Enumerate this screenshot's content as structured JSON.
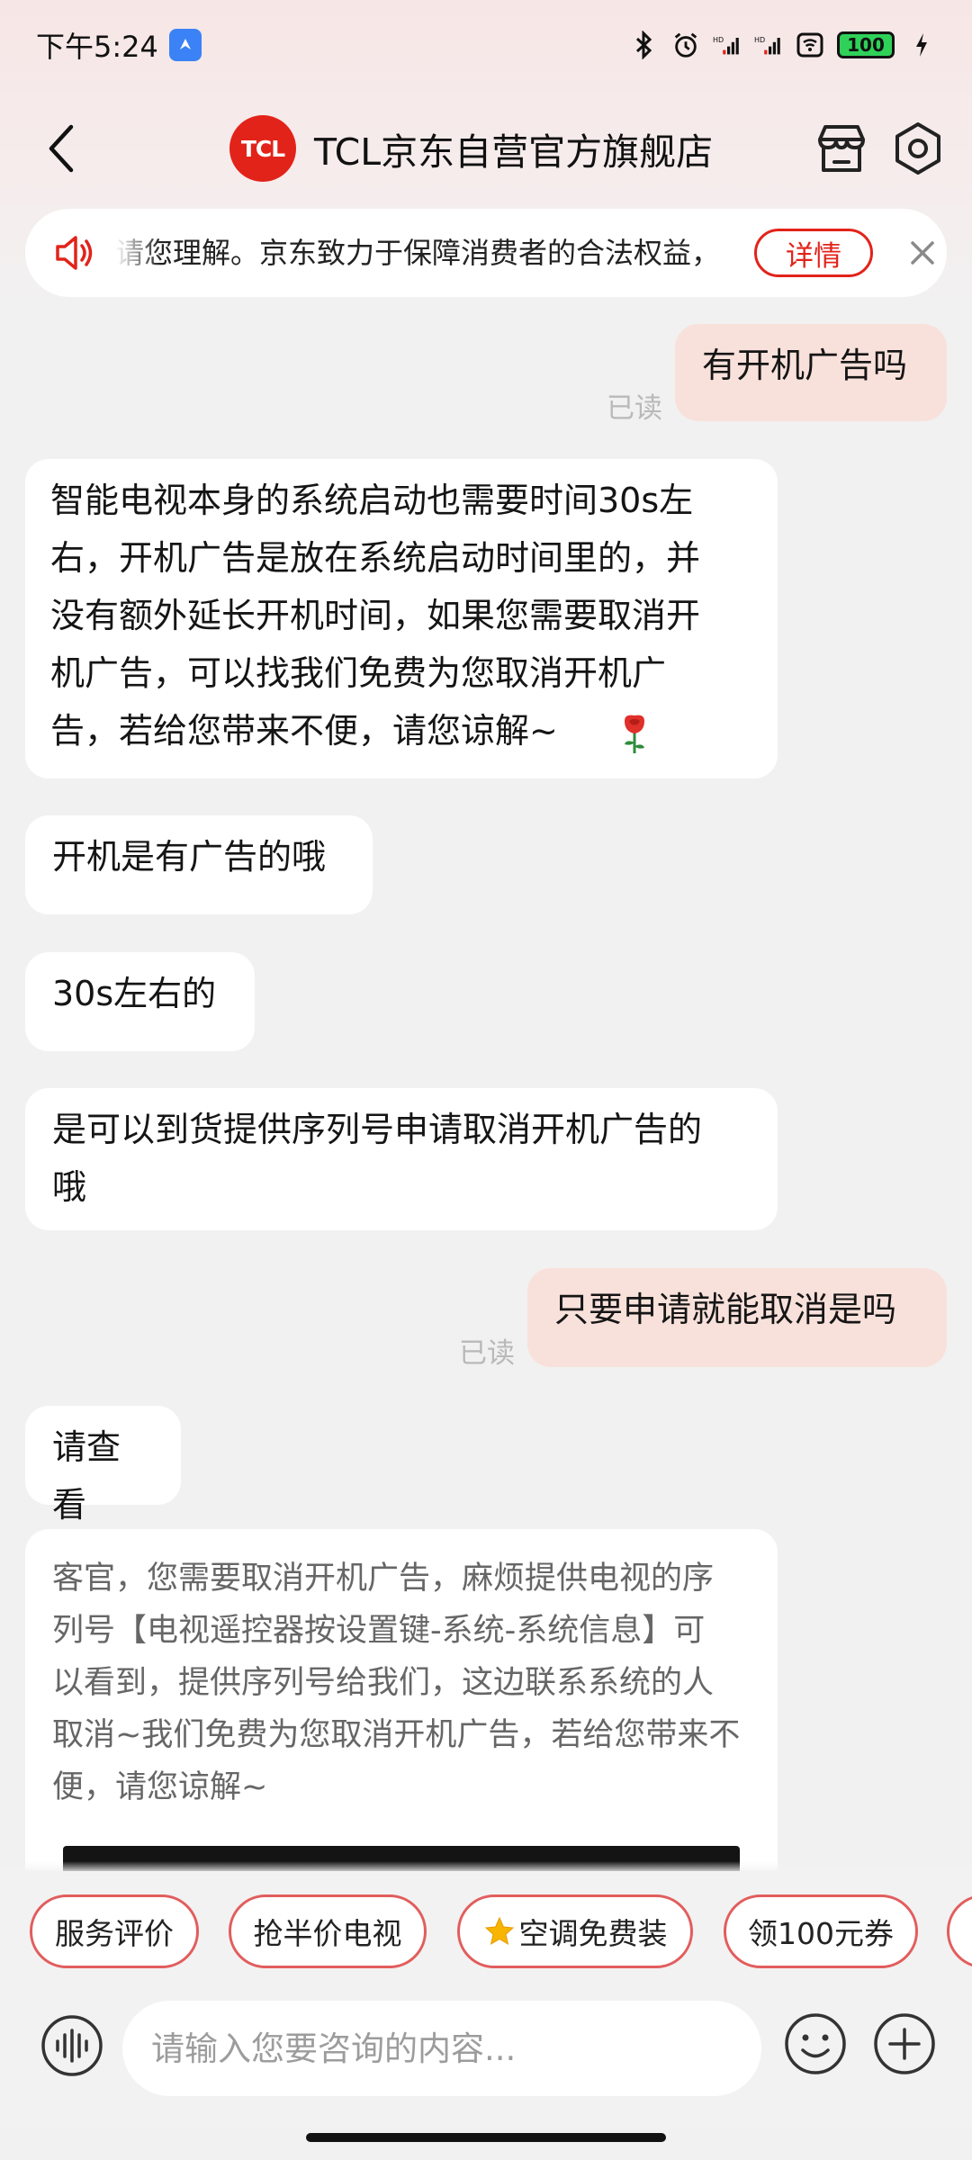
{
  "status_bar": {
    "time": "下午5:24",
    "battery": "100",
    "icons": [
      "app-notification-icon",
      "bluetooth-icon",
      "alarm-icon",
      "signal-hd-icon",
      "signal-hd-icon",
      "wifi-icon",
      "battery-icon",
      "charging-icon"
    ]
  },
  "header": {
    "store_logo_text": "TCL",
    "store_name": "TCL京东自营官方旗舰店",
    "icons": [
      "back-icon",
      "shop-icon",
      "settings-icon"
    ]
  },
  "notice": {
    "text": "请您理解。京东致力于保障消费者的合法权益，",
    "detail_label": "详情",
    "icons": [
      "speaker-icon",
      "close-icon"
    ]
  },
  "messages": [
    {
      "from": "me",
      "text": "有开机广告吗",
      "read": "已读"
    },
    {
      "from": "agent",
      "text": "智能电视本身的系统启动也需要时间30s左右，开机广告是放在系统启动时间里的，并没有额外延长开机时间，如果您需要取消开机广告，可以找我们免费为您取消开机广告，若给您带来不便，请您谅解~",
      "lines": [
        "智能电视本身的系统启动也需要时间30s左",
        "右，开机广告是放在系统启动时间里的，并",
        "没有额外延长开机时间，如果您需要取消开",
        "机广告，可以找我们免费为您取消开机广",
        "告，若给您带来不便，请您谅解~"
      ],
      "emoji": "rose-icon"
    },
    {
      "from": "agent",
      "text": "开机是有广告的哦"
    },
    {
      "from": "agent",
      "text": "30s左右的"
    },
    {
      "from": "agent",
      "text": "是可以到货提供序列号申请取消开机广告的哦",
      "lines": [
        "是可以到货提供序列号申请取消开机广告的",
        "哦"
      ]
    },
    {
      "from": "me",
      "text": "只要申请就能取消是吗",
      "read": "已读"
    },
    {
      "from": "agent",
      "text": "请查看"
    },
    {
      "from": "agent",
      "type": "card",
      "text": "客官，您需要取消开机广告，麻烦提供电视的序列号【电视遥控器按设置键-系统-系统信息】可以看到，提供序列号给我们，这边联系系统的人取消~我们免费为您取消开机广告，若给您带来不便，请您谅解~",
      "lines": [
        "客官，您需要取消开机广告，麻烦提供电视的序",
        "列号【电视遥控器按设置键-系统-系统信息】可",
        "以看到，提供序列号给我们，这边联系系统的人",
        "取消~我们免费为您取消开机广告，若给您带来不",
        "便，请您谅解~"
      ]
    }
  ],
  "quick_replies": [
    {
      "label": "服务评价"
    },
    {
      "label": "抢半价电视"
    },
    {
      "label": "空调免费装",
      "icon": "star-icon"
    },
    {
      "label": "领100元券"
    }
  ],
  "input_bar": {
    "placeholder": "请输入您要咨询的内容...",
    "icons": [
      "voice-icon",
      "emoji-icon",
      "plus-icon"
    ]
  },
  "colors": {
    "brand_red": "#e2231a",
    "my_bubble": "#f9e1db",
    "agent_bubble": "#ffffff",
    "background": "#f1f1f1",
    "read_mark": "#b9b9b9",
    "chip_border": "#e25d5d"
  }
}
